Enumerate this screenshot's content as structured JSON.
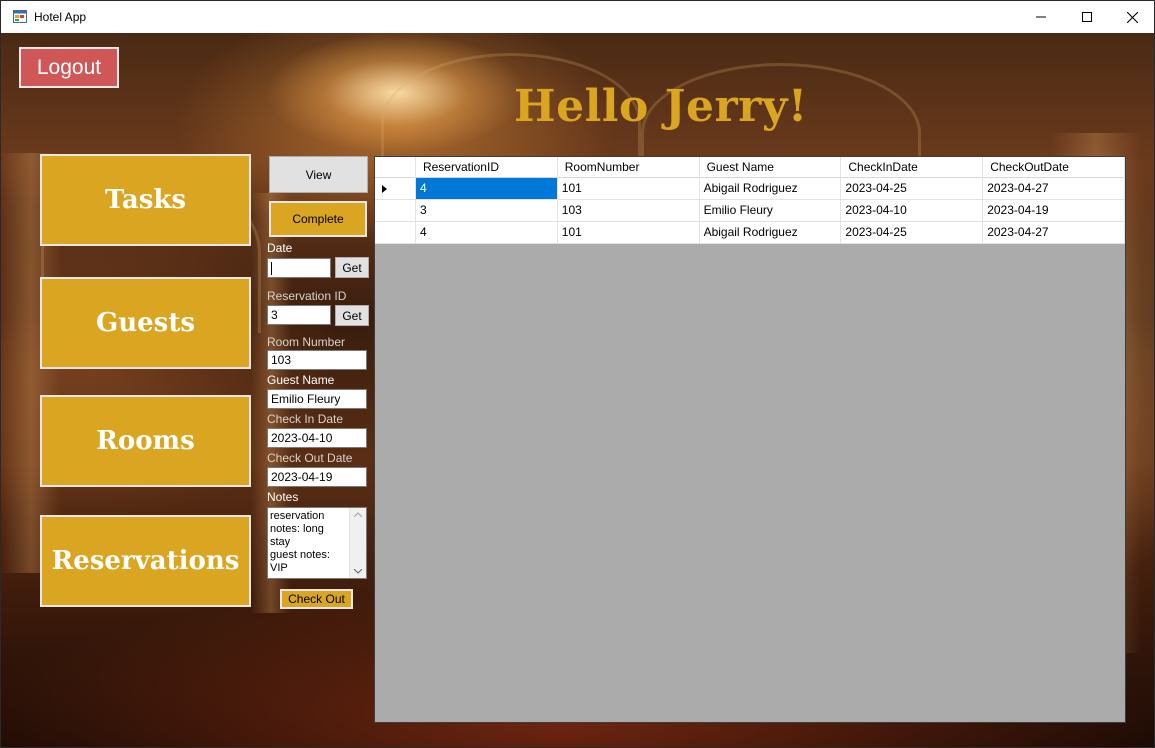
{
  "window": {
    "title": "Hotel App",
    "icon": "app-window-icon"
  },
  "header": {
    "logout_label": "Logout",
    "greeting": "Hello Jerry!"
  },
  "nav": {
    "tasks": "Tasks",
    "guests": "Guests",
    "rooms": "Rooms",
    "reservations": "Reservations"
  },
  "panel": {
    "view_label": "View",
    "complete_label": "Complete",
    "date_label": "Date",
    "date_value": "",
    "get_label": "Get",
    "reservation_id_label": "Reservation ID",
    "reservation_id_value": "3",
    "room_number_label": "Room Number",
    "room_number_value": "103",
    "guest_name_label": "Guest Name",
    "guest_name_value": "Emilio Fleury",
    "check_in_label": "Check In Date",
    "check_in_value": "2023-04-10",
    "check_out_label": "Check Out Date",
    "check_out_value": "2023-04-19",
    "notes_label": "Notes",
    "notes_lines": [
      "reservation",
      "notes: long",
      "stay",
      "guest notes:",
      "VIP"
    ],
    "checkout_label": "Check Out"
  },
  "grid": {
    "columns": [
      "ReservationID",
      "RoomNumber",
      "Guest Name",
      "CheckInDate",
      "CheckOutDate"
    ],
    "rows": [
      [
        "4",
        "101",
        "Abigail Rodriguez",
        "2023-04-25",
        "2023-04-27"
      ],
      [
        "3",
        "103",
        "Emilio Fleury",
        "2023-04-10",
        "2023-04-19"
      ],
      [
        "4",
        "101",
        "Abigail Rodriguez",
        "2023-04-25",
        "2023-04-27"
      ]
    ]
  },
  "colors": {
    "gold": "#daa520",
    "logout_red": "#d05757",
    "selection_blue": "#0078d7",
    "grid_background": "#ababab"
  }
}
